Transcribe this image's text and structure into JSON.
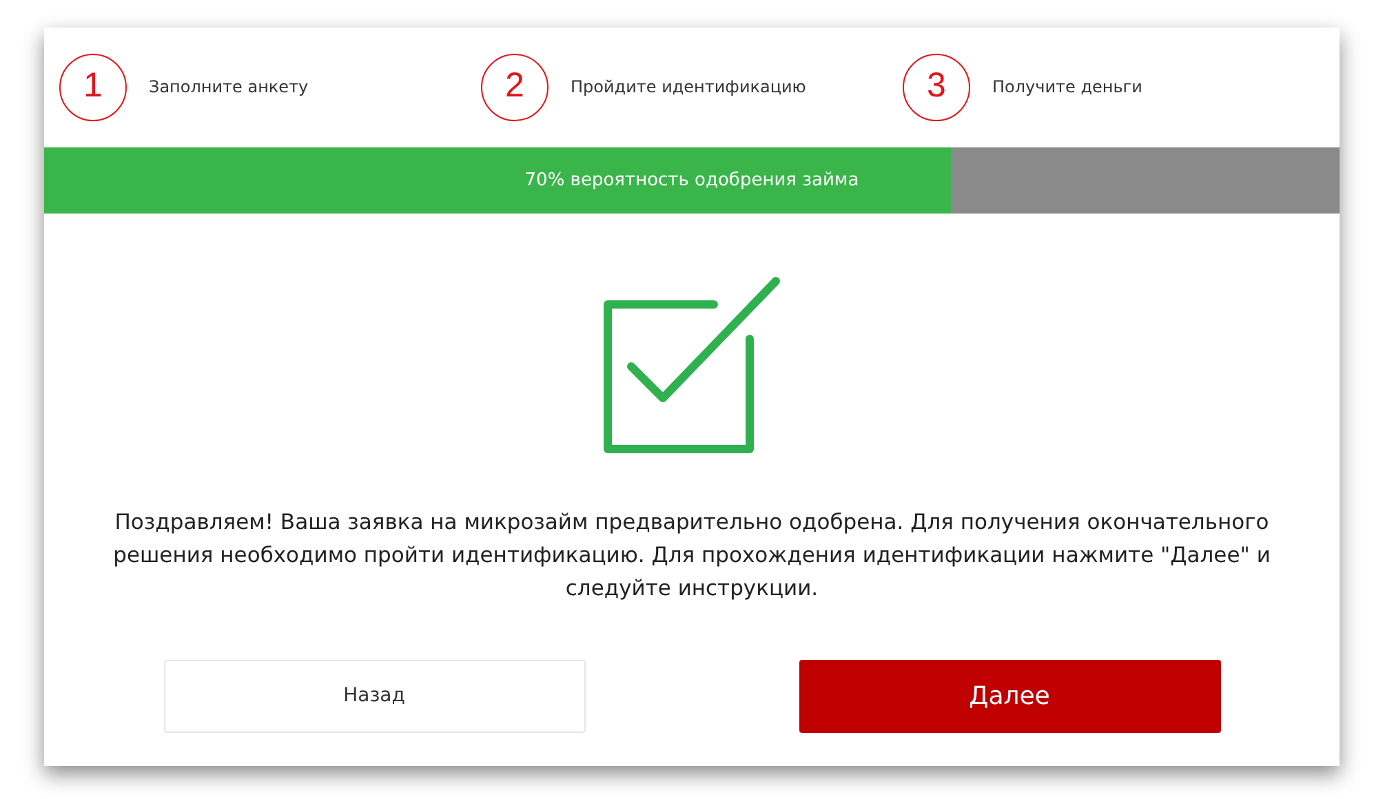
{
  "steps": [
    {
      "number": "1",
      "label": "Заполните анкету"
    },
    {
      "number": "2",
      "label": "Пройдите идентификацию"
    },
    {
      "number": "3",
      "label": "Получите деньги"
    }
  ],
  "progress": {
    "level": 0.7,
    "text": "70% вероятность одобрения займа"
  },
  "message": "Поздравляем! Ваша заявка на микрозайм предварительно одобрена. Для получения окончательного решения необходимо пройти идентификацию. Для прохождения идентификации нажмите \"Далее\" и следуйте инструкции.",
  "buttons": [
    {
      "label": "Назад",
      "kind": "secondary"
    },
    {
      "label": "Далее",
      "kind": "primary"
    }
  ]
}
